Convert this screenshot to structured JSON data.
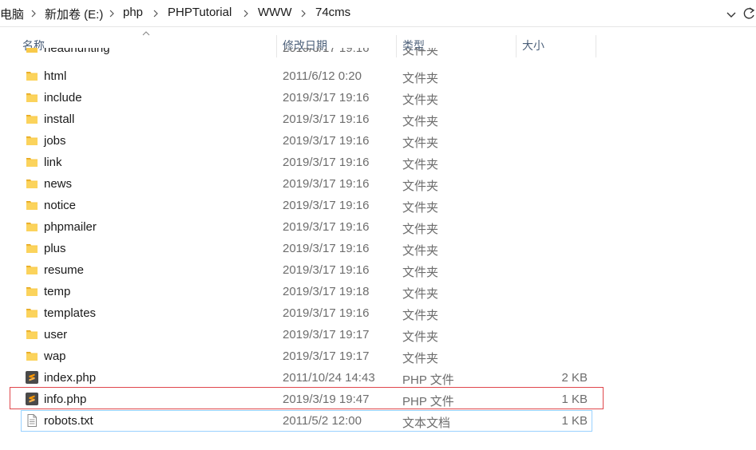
{
  "address_bar": {
    "crumbs": [
      "电脑",
      "新加卷 (E:)",
      "php",
      "PHPTutorial",
      "WWW",
      "74cms"
    ]
  },
  "columns": {
    "name": "名称",
    "date": "修改日期",
    "type": "类型",
    "size": "大小"
  },
  "partial_row": {
    "name": "headhunting",
    "date": "2019/3/17 19:16",
    "type": "文件夹"
  },
  "files": [
    {
      "name": "html",
      "date": "2011/6/12 0:20",
      "type": "文件夹",
      "size": "",
      "icon": "folder-icon"
    },
    {
      "name": "include",
      "date": "2019/3/17 19:16",
      "type": "文件夹",
      "size": "",
      "icon": "folder-icon"
    },
    {
      "name": "install",
      "date": "2019/3/17 19:16",
      "type": "文件夹",
      "size": "",
      "icon": "folder-icon"
    },
    {
      "name": "jobs",
      "date": "2019/3/17 19:16",
      "type": "文件夹",
      "size": "",
      "icon": "folder-icon"
    },
    {
      "name": "link",
      "date": "2019/3/17 19:16",
      "type": "文件夹",
      "size": "",
      "icon": "folder-icon"
    },
    {
      "name": "news",
      "date": "2019/3/17 19:16",
      "type": "文件夹",
      "size": "",
      "icon": "folder-icon"
    },
    {
      "name": "notice",
      "date": "2019/3/17 19:16",
      "type": "文件夹",
      "size": "",
      "icon": "folder-icon"
    },
    {
      "name": "phpmailer",
      "date": "2019/3/17 19:16",
      "type": "文件夹",
      "size": "",
      "icon": "folder-icon"
    },
    {
      "name": "plus",
      "date": "2019/3/17 19:16",
      "type": "文件夹",
      "size": "",
      "icon": "folder-icon"
    },
    {
      "name": "resume",
      "date": "2019/3/17 19:16",
      "type": "文件夹",
      "size": "",
      "icon": "folder-icon"
    },
    {
      "name": "temp",
      "date": "2019/3/17 19:18",
      "type": "文件夹",
      "size": "",
      "icon": "folder-icon"
    },
    {
      "name": "templates",
      "date": "2019/3/17 19:16",
      "type": "文件夹",
      "size": "",
      "icon": "folder-icon"
    },
    {
      "name": "user",
      "date": "2019/3/17 19:17",
      "type": "文件夹",
      "size": "",
      "icon": "folder-icon"
    },
    {
      "name": "wap",
      "date": "2019/3/17 19:17",
      "type": "文件夹",
      "size": "",
      "icon": "folder-icon"
    },
    {
      "name": "index.php",
      "date": "2011/10/24 14:43",
      "type": "PHP 文件",
      "size": "2 KB",
      "icon": "sublime-php-icon"
    },
    {
      "name": "info.php",
      "date": "2019/3/19 19:47",
      "type": "PHP 文件",
      "size": "1 KB",
      "icon": "sublime-php-icon"
    },
    {
      "name": "robots.txt",
      "date": "2011/5/2 12:00",
      "type": "文本文档",
      "size": "1 KB",
      "icon": "text-document-icon"
    }
  ],
  "colors": {
    "folder": "#f8c94a",
    "folder_dark": "#e6a81f",
    "highlight_border": "#e0474c",
    "focus_border": "#99d1ff",
    "header_text": "#4c607a"
  }
}
